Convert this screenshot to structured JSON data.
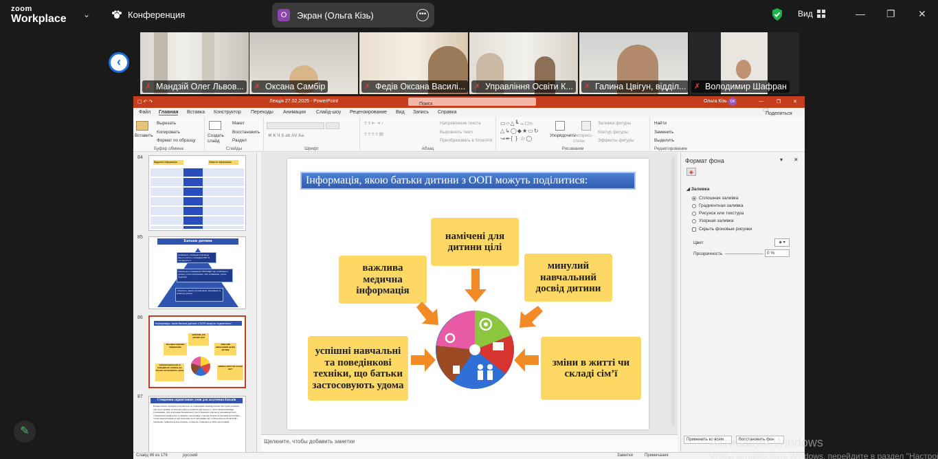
{
  "zoom": {
    "logo_top": "zoom",
    "logo_bottom": "Workplace",
    "meeting_title": "Конференция",
    "share_label": "Экран (Ольга Кізь)",
    "share_avatar": "О",
    "view_label": "Вид",
    "participants": [
      {
        "name": "Мандзій Олег Львов..."
      },
      {
        "name": "Оксана Самбір"
      },
      {
        "name": "Федів Оксана Василі..."
      },
      {
        "name": "Управління Освіти К..."
      },
      {
        "name": "Галина Цвігун, відділ..."
      },
      {
        "name": "Володимир Шафран"
      }
    ],
    "watermark_line1": "Активация Windows",
    "watermark_line2": "Чтобы активировать Windows, перейдите в раздел \"Настройки\", щоб"
  },
  "ppt": {
    "file_title": "Лекція 27.02.2025  -  PowerPoint",
    "search_placeholder": "Поиск",
    "user_name": "Ольга Кізь",
    "user_initials": "ОК",
    "share_button": "Поделиться",
    "tabs": [
      "Файл",
      "Главная",
      "Вставка",
      "Конструктор",
      "Переходы",
      "Анимация",
      "Слайд-шоу",
      "Рецензирование",
      "Вид",
      "Запись",
      "Справка"
    ],
    "ribbon": {
      "paste": "Вставить",
      "cut": "Вырезать",
      "copy": "Копировать",
      "format_painter": "Формат по образцу",
      "clipboard_caption": "Буфер обмена",
      "new_slide": "Создать слайд",
      "layout": "Макет",
      "reset": "Восстановить",
      "section": "Раздел",
      "slides_caption": "Слайды",
      "font_caption": "Шрифт",
      "text_direction": "Направление текста",
      "align_text": "Выровнять текст",
      "smartart": "Преобразовать в SmartArt",
      "paragraph_caption": "Абзац",
      "arrange": "Упорядочить",
      "quick_styles": "Экспресс-стили",
      "fill": "Заливка фигуры",
      "outline": "Контур фигуры",
      "effects": "Эффекты фигуры",
      "drawing_caption": "Рисование",
      "find": "Найти",
      "replace": "Заменить",
      "select": "Выделить",
      "editing_caption": "Редактирование"
    },
    "thumbnails": [
      {
        "num": "84",
        "left_head": "Відкрита інформація",
        "right_head": "Закрита інформація"
      },
      {
        "num": "85",
        "title": "Батьки дитини",
        "item1": "приймають у Команді супроводу беруть участь у складанні ІПР та погоджують її",
        "item2": "інформують працівників ЗЗСО/ЗДО про особливості дитини, стиль спілкування, свої побажання, успіхи, труднощі",
        "item3": "створюють умови для навчання, виховання та розвитку дитини"
      },
      {
        "num": "86",
        "title": "Інформація, якою батьки дитини з ООП можуть поділитися:",
        "b1": "важлива медична інформація",
        "b2": "намічені для дитини цілі",
        "b3": "минулий навчальний досвід дитини",
        "b4": "успішні навчальні та поведінкові техніки, що батьки застосовують удома",
        "b5": "зміни в житті чи складі сім'ї"
      },
      {
        "num": "87",
        "title": "Створення сприятливих умов для залучення батьків",
        "body": "Батьки значно залюбки долучаються до планування індивідуальної програми розвитку для своєї дитини, коли вони добре розуміють цей процес і є його рівноправними учасниками. Для залучення батьківської участі Команді супроводу рекомендується: •створювати комфортне та приязне середовище, в якому батьки почуватимуться вільно; •заохочувати батьків до висловлення своєї підтримки про успіхи при реалізації ІПР і побажань; •уникати думок батьків, з повагою ставитися до їхніх пропозицій."
      }
    ],
    "slide": {
      "title": "Інформація, якою батьки дитини з ООП можуть поділитися:",
      "box_medical": "важлива медична інформація",
      "box_goals": "намічені для дитини цілі",
      "box_past": "минулий навчальний досвід дитини",
      "box_techniques": "успішні навчальні та поведінкові техніки, що батьки застосовують удома",
      "box_changes": "зміни в житті чи складі сім’ї"
    },
    "notes_placeholder": "Щелкните, чтобы добавить заметки",
    "format_pane": {
      "title": "Формат фона",
      "section": "Заливка",
      "options": [
        "Сплошная заливка",
        "Градиентная заливка",
        "Рисунок или текстура",
        "Узорная заливка",
        "Скрыть фоновые рисунки"
      ],
      "selected_option": "Сплошная заливка",
      "color_label": "Цвет",
      "transparency_label": "Прозрачность",
      "transparency_value": "0 %",
      "apply_all": "Применить ко всем",
      "reset": "Восстановить фон"
    },
    "status": {
      "slide_info": "Слайд 86 из 176",
      "language": "русский",
      "notes": "Заметки",
      "comments": "Примечания"
    }
  },
  "colors": {
    "ppt_accent": "#c43e1c",
    "slide_box": "#fed864",
    "slide_arrow": "#f28a26",
    "zoom_blue": "#1e6fe0"
  }
}
